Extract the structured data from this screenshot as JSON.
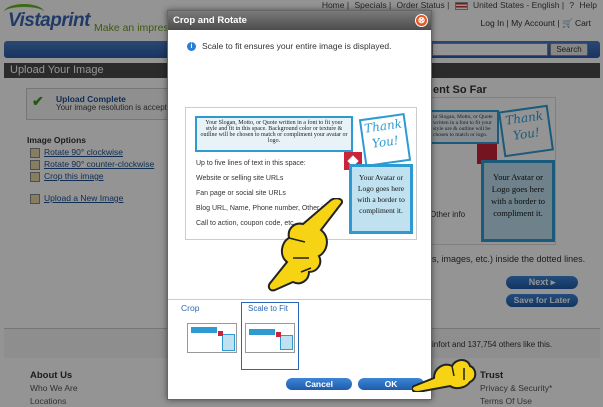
{
  "header": {
    "links": [
      "Home",
      "Specials",
      "Order Status",
      "United States - English",
      "Help"
    ],
    "tagline": "Make an impressio",
    "logo": "Vistaprint",
    "login": "Log In",
    "my_account": "My Account",
    "cart": "Cart",
    "search_label": "Search"
  },
  "page": {
    "section_title": "Upload Your Image",
    "upload_title": "Upload Complete",
    "upload_desc": "Your image resolution is accepta",
    "options_title": "Image Options",
    "options": [
      "Rotate 90° clockwise",
      "Rotate 90° counter-clockwise",
      "Crop this image",
      "Upload a New Image"
    ],
    "right_title": "ent So Far",
    "dotted_note": "s, images, etc.) inside the dotted lines.",
    "next": "Next",
    "save_for_later": "Save for Later",
    "social": "infort         and 137,754 others like this.",
    "footer_about": "About Us",
    "footer_about_links": [
      "Who We Are",
      "Locations"
    ],
    "footer_trust": "Trust",
    "footer_trust_links": [
      "Privacy & Security*",
      "Terms Of Use"
    ]
  },
  "dialog": {
    "title": "Crop and Rotate",
    "close": "⊗",
    "info": "Scale to fit ensures your entire image is displayed.",
    "card": {
      "slogan": "Your Slogan, Motto, or Quote written in a font to fit your style and fit in this space. Background color or texture & outline will be chosen to match or compliment your avatar or logo.",
      "thank": "Thank You!",
      "avatar": "Your Avatar or Logo goes here with a border to compliment it.",
      "lines": [
        "Up to five lines of text in this space:",
        "Website or selling site URLs",
        "Fan page or social site URLs",
        "Blog URL, Name, Phone number, Other info",
        "Call to action, coupon code, etc."
      ]
    },
    "tab_crop": "Crop",
    "tab_scale": "Scale to Fit",
    "cancel": "Cancel",
    "ok": "OK"
  },
  "right_preview": {
    "slogan": "ur Slogan, Motto, or Quote written in a font to fit your style ure & outline will be chosen to match or logo.",
    "thank": "Thank You!",
    "avatar": "Your Avatar or Logo goes here with a border to compliment it.",
    "other": "Other info"
  },
  "colors": {
    "brand_blue": "#2a5ba6",
    "accent_green": "#6bb62a",
    "highlight_blue": "#2d9bd2",
    "close_orange": "#e3572b"
  }
}
